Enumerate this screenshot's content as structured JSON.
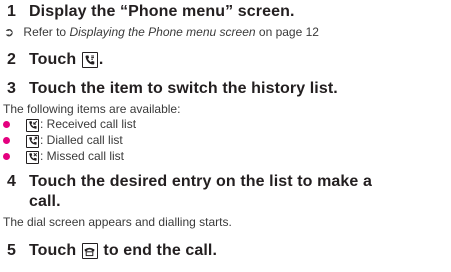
{
  "steps": [
    {
      "num": "1",
      "text": "Display the “Phone menu” screen."
    },
    {
      "num": "2",
      "text_before": "Touch ",
      "text_after": "."
    },
    {
      "num": "3",
      "text": "Touch the item to switch the history list."
    },
    {
      "num": "4",
      "line1": "Touch the desired entry on the list to make a",
      "line2": "call."
    },
    {
      "num": "5",
      "text_before": "Touch ",
      "text_after": " to end the call."
    }
  ],
  "reference": {
    "arrow": "➲",
    "prefix": "Refer to ",
    "link": "Displaying the Phone menu screen",
    "suffix": " on page 12"
  },
  "intro": "The following items are available:",
  "items": [
    {
      "label": ": Received call list",
      "icon": "received-call-icon"
    },
    {
      "label": ": Dialled call list",
      "icon": "dialled-call-icon"
    },
    {
      "label": ": Missed call list",
      "icon": "missed-call-icon"
    }
  ],
  "result": "The dial screen appears and dialling starts.",
  "colors": {
    "bullet": "#e4007f",
    "text": "#231f20"
  },
  "icons": {
    "step2": "phone-history-icon",
    "step5": "end-call-icon"
  }
}
